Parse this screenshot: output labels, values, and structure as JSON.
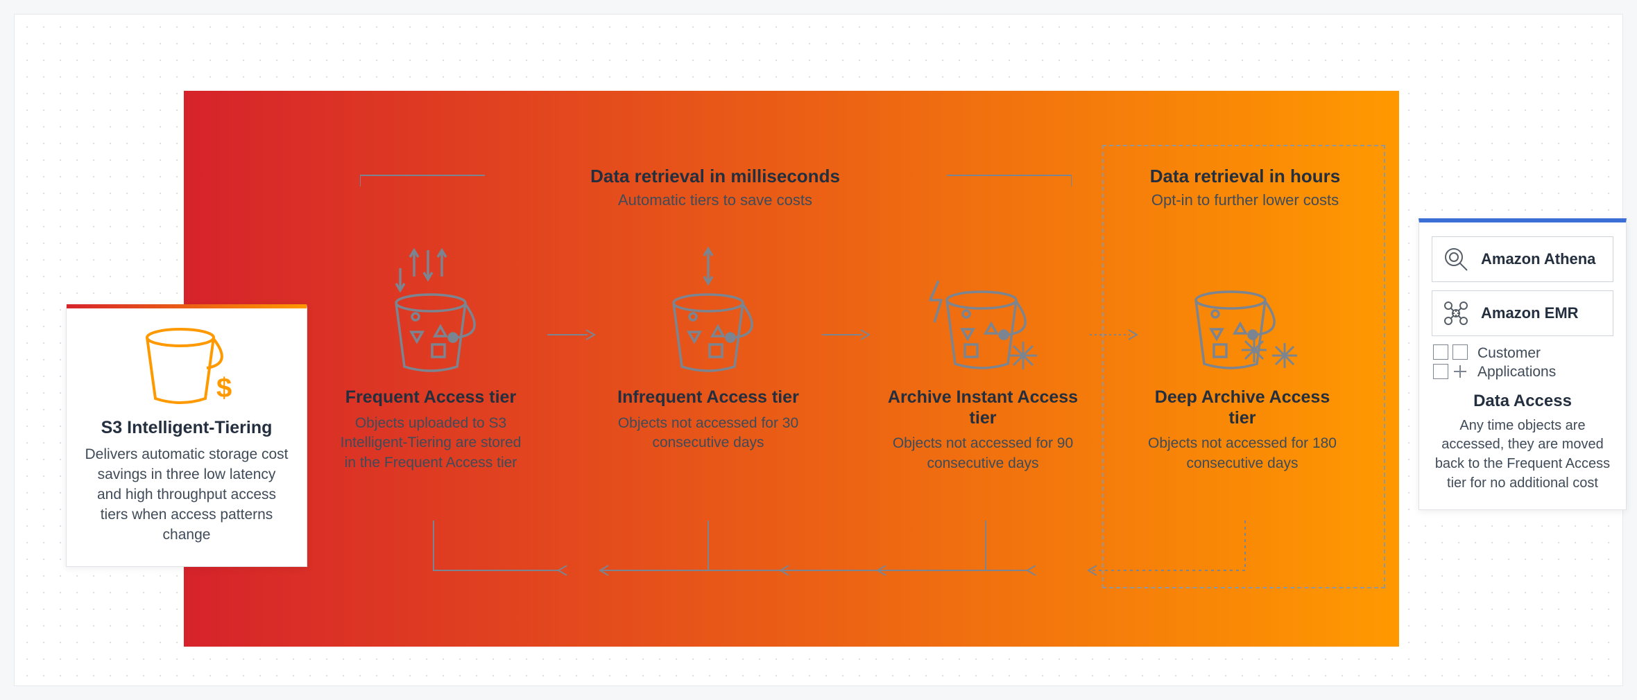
{
  "sections": {
    "ms": {
      "title": "Data retrieval in milliseconds",
      "sub": "Automatic tiers to save costs"
    },
    "hrs": {
      "title": "Data retrieval in hours",
      "sub": "Opt-in to further lower costs"
    }
  },
  "left_card": {
    "title": "S3 Intelligent-Tiering",
    "desc": "Delivers automatic storage cost savings in three low latency and high throughput access tiers when access patterns change"
  },
  "tiers": {
    "frequent": {
      "title": "Frequent Access tier",
      "desc": "Objects uploaded to S3 Intelligent-Tiering are stored in the Frequent Access tier"
    },
    "infrequent": {
      "title": "Infrequent Access tier",
      "desc": "Objects not accessed for 30 consecutive days"
    },
    "archive_instant": {
      "title": "Archive Instant Access tier",
      "desc": "Objects not accessed for 90 consecutive days"
    },
    "deep_archive": {
      "title": "Deep Archive Access tier",
      "desc": "Objects not accessed for 180 consecutive days"
    }
  },
  "right_card": {
    "athena": "Amazon Athena",
    "emr": "Amazon EMR",
    "customer_line1": "Customer",
    "customer_line2": "Applications",
    "title": "Data Access",
    "desc": "Any time objects are accessed, they are moved back to the Frequent Access tier for no additional cost"
  }
}
